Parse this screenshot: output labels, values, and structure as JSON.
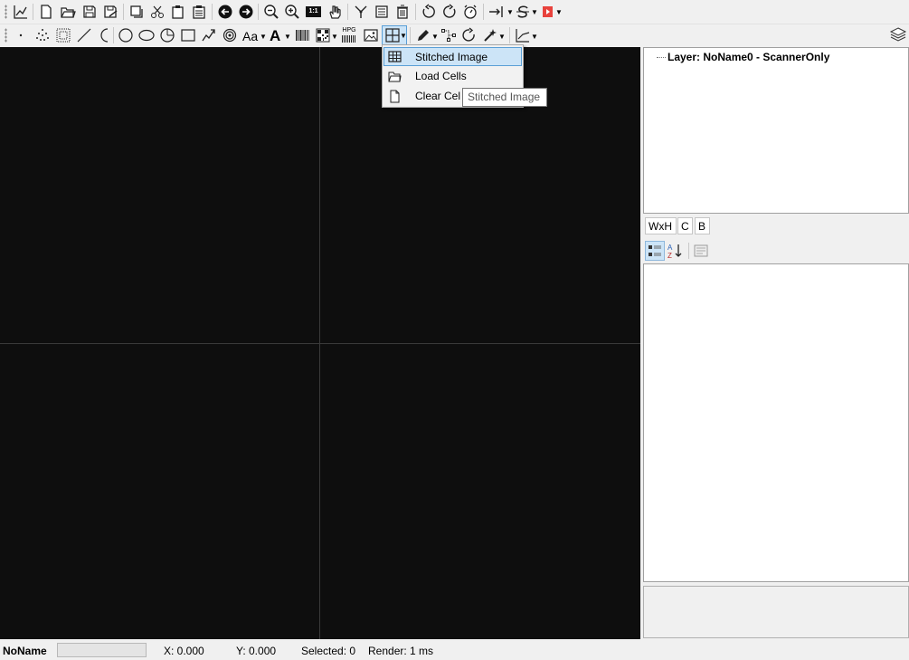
{
  "toolbar_row1": {
    "icons": [
      "chart-icon",
      "new-file-icon",
      "open-folder-icon",
      "save-icon",
      "save-as-icon",
      "copy-icon",
      "cut-icon",
      "paste-icon",
      "clipboard-icon",
      "undo-arrow-icon",
      "redo-arrow-icon",
      "zoom-out-icon",
      "zoom-in-icon",
      "zoom-1to1-icon",
      "pan-hand-icon",
      "select-node-icon",
      "list-icon",
      "delete-icon",
      "rotate-ccw-icon",
      "rotate-cw-icon",
      "timer-icon",
      "align-icon",
      "s-path-icon",
      "red-play-icon"
    ],
    "zoom_1to1_label": "1:1"
  },
  "toolbar_row2": {
    "icons": [
      "point-icon",
      "scatter-points-icon",
      "dot-grid-icon",
      "line-icon",
      "arc-icon",
      "circle-icon",
      "ellipse-icon",
      "circle-arc-icon",
      "rectangle-icon",
      "spiral-icon",
      "concentric-circles-icon",
      "text-font-icon",
      "bold-text-icon",
      "barcode-icon",
      "qr-code-icon",
      "hpgl-icon",
      "image-icon",
      "grid-cells-icon",
      "pen-icon",
      "node-edit-icon",
      "rotate-icon",
      "wand-icon",
      "graph-icon",
      "layers-icon"
    ],
    "text_font_label": "Aa",
    "bold_text_label": "A",
    "hpgl_label": "HPG"
  },
  "menu": {
    "items": [
      {
        "label": "Stitched Image",
        "icon": "grid-icon",
        "selected": true
      },
      {
        "label": "Load Cells",
        "icon": "folder-icon",
        "selected": false
      },
      {
        "label": "Clear Cel",
        "icon": "blank-page-icon",
        "selected": false
      }
    ],
    "tooltip": "Stitched Image"
  },
  "layers": {
    "node_label": "Layer: NoName0 - ScannerOnly"
  },
  "tabs": [
    "WxH",
    "C",
    "B"
  ],
  "status": {
    "name": "NoName",
    "x": "X: 0.000",
    "y": "Y: 0.000",
    "selected": "Selected: 0",
    "render": "Render: 1 ms"
  },
  "colors": {
    "canvas_bg": "#0e0e0e",
    "canvas_grid": "#3a3a3a",
    "menu_highlight": "#cce4f7",
    "menu_highlight_border": "#5a9fd6"
  }
}
